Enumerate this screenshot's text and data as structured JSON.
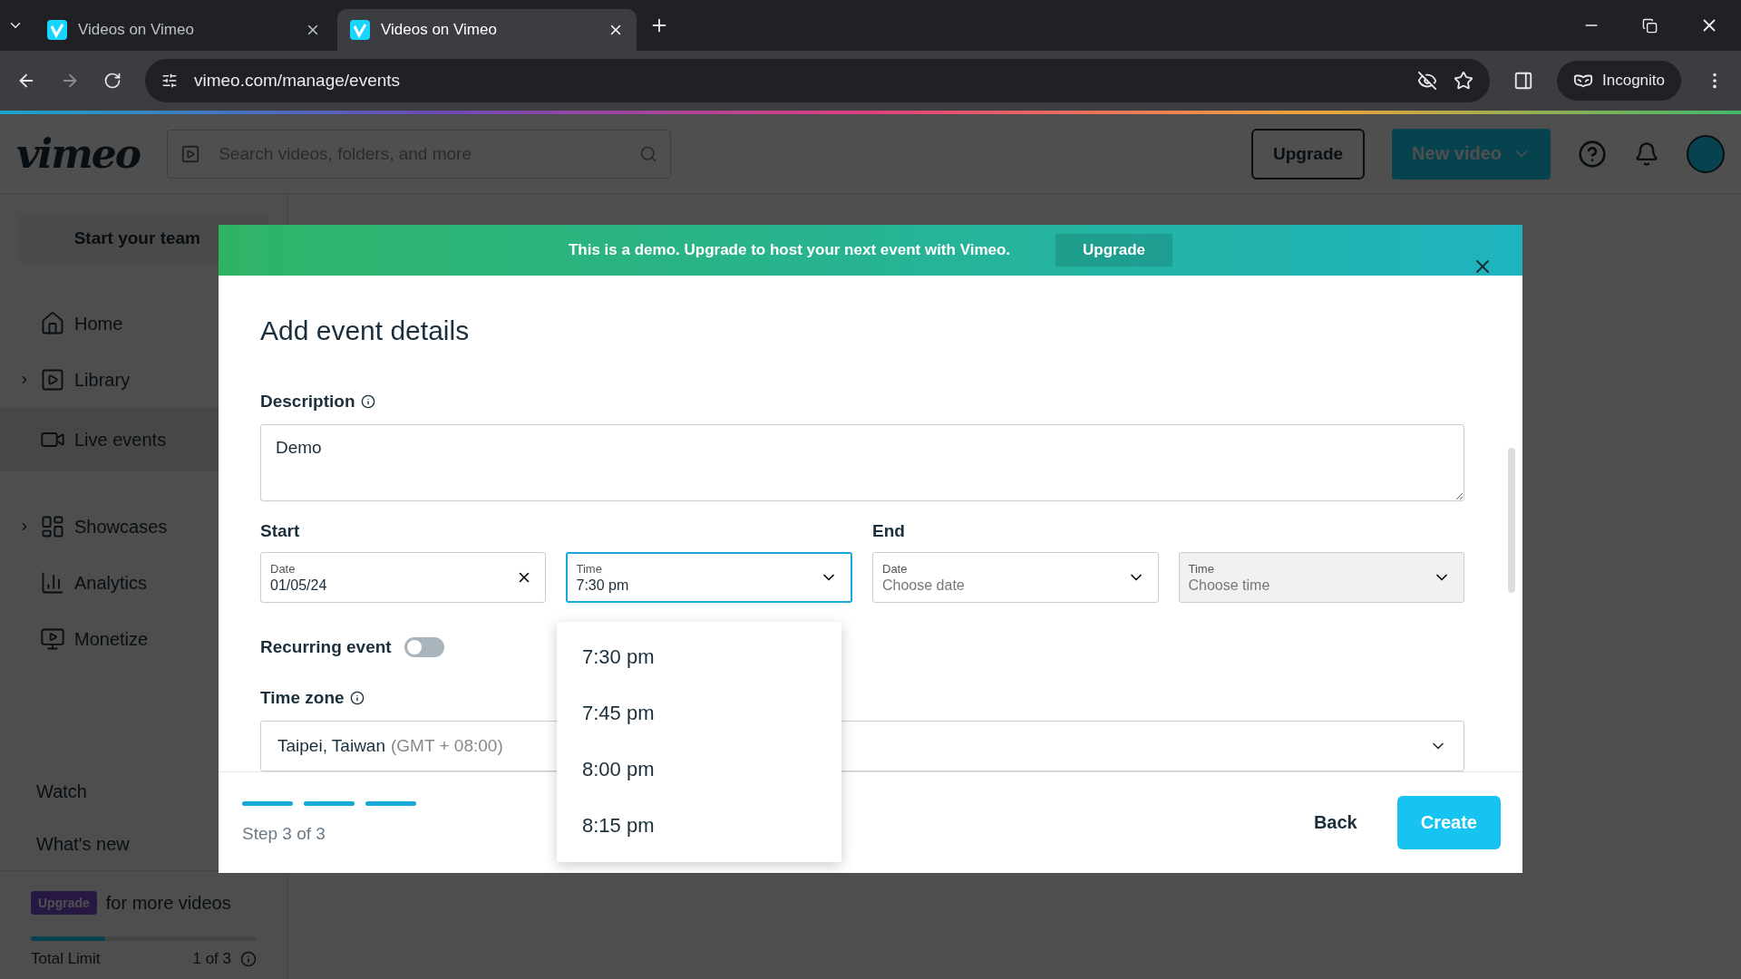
{
  "browser": {
    "tabs": [
      {
        "title": "Videos on Vimeo",
        "selected": false
      },
      {
        "title": "Videos on Vimeo",
        "selected": true
      }
    ],
    "url": "vimeo.com/manage/events",
    "profile": "Incognito"
  },
  "header": {
    "logo": "vimeo",
    "search_placeholder": "Search videos, folders, and more",
    "upgrade": "Upgrade",
    "new_video": "New video"
  },
  "sidebar": {
    "team_button": "Start your team",
    "items": [
      {
        "label": "Home",
        "expandable": false,
        "selected": false
      },
      {
        "label": "Library",
        "expandable": true,
        "selected": false
      },
      {
        "label": "Live events",
        "expandable": false,
        "selected": true
      },
      {
        "label": "Showcases",
        "expandable": true,
        "selected": false
      },
      {
        "label": "Analytics",
        "expandable": false,
        "selected": false
      },
      {
        "label": "Monetize",
        "expandable": false,
        "selected": false
      }
    ],
    "links": [
      "Watch",
      "What's new"
    ],
    "upgrade_badge": "Upgrade",
    "upgrade_text": "for more videos",
    "limit_label": "Total Limit",
    "limit_count": "1 of 3",
    "limit": {
      "level": 0.33
    }
  },
  "modal": {
    "banner": {
      "text": "This is a demo. Upgrade to host your next event with Vimeo.",
      "button": "Upgrade"
    },
    "title": "Add event details",
    "description": {
      "label": "Description",
      "value": "Demo"
    },
    "start": {
      "label": "Start",
      "fields": [
        {
          "label": "Date",
          "value": "01/05/24",
          "kind": "clear",
          "focused": false,
          "disabled": false
        },
        {
          "label": "Time",
          "value": "7:30 pm",
          "kind": "select",
          "focused": true,
          "disabled": false
        }
      ]
    },
    "end": {
      "label": "End",
      "fields": [
        {
          "label": "Date",
          "placeholder": "Choose date",
          "kind": "select",
          "focused": false,
          "disabled": false
        },
        {
          "label": "Time",
          "placeholder": "Choose time",
          "kind": "select",
          "focused": false,
          "disabled": true
        }
      ]
    },
    "recurring": {
      "label": "Recurring event",
      "on": false
    },
    "timezone": {
      "label": "Time zone",
      "value": "Taipei, Taiwan",
      "offset": "(GMT + 08:00)"
    },
    "time_options": [
      "7:30 pm",
      "7:45 pm",
      "8:00 pm",
      "8:15 pm"
    ],
    "progress": [
      {
        "done": true
      },
      {
        "done": true
      },
      {
        "done": true
      }
    ],
    "step": "Step 3 of 3",
    "back": "Back",
    "create": "Create"
  }
}
